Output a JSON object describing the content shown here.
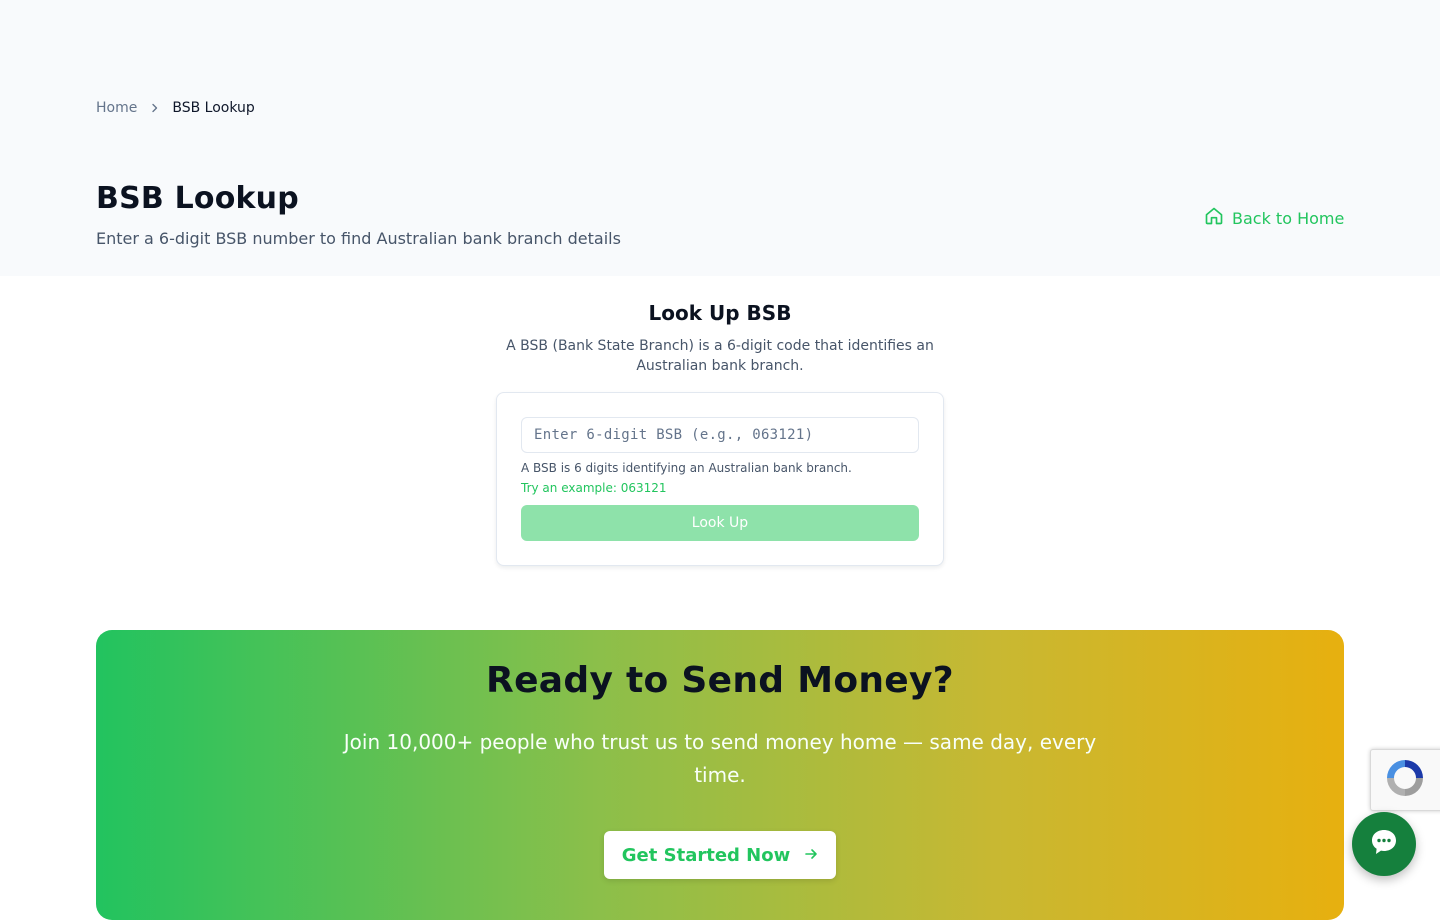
{
  "breadcrumb": {
    "home_label": "Home",
    "current_label": "BSB Lookup"
  },
  "header": {
    "title": "BSB Lookup",
    "subtitle": "Enter a 6-digit BSB number to find Australian bank branch details",
    "back_link_label": "Back to Home"
  },
  "lookup": {
    "title": "Look Up BSB",
    "description": "A BSB (Bank State Branch) is a 6-digit code that identifies an Australian bank branch.",
    "input_value": "",
    "input_placeholder": "Enter 6-digit BSB (e.g., 063121)",
    "hint": "A BSB is 6 digits identifying an Australian bank branch.",
    "example_label": "Try an example: 063121",
    "button_label": "Look Up"
  },
  "cta": {
    "title": "Ready to Send Money?",
    "text": "Join 10,000+ people who trust us to send money home — same day, every time.",
    "button_label": "Get Started Now"
  },
  "icons": {
    "breadcrumb_separator": "chevron-right-icon",
    "back_home": "home-icon",
    "cta_arrow": "arrow-right-icon",
    "recaptcha": "recaptcha-logo",
    "chat": "chat-bubble-icon"
  },
  "colors": {
    "accent": "#22c55e",
    "button_disabled": "#8ee2aa",
    "chat_button": "#15803d",
    "gradient_start": "#22c35f",
    "gradient_end": "#e7b00f"
  }
}
